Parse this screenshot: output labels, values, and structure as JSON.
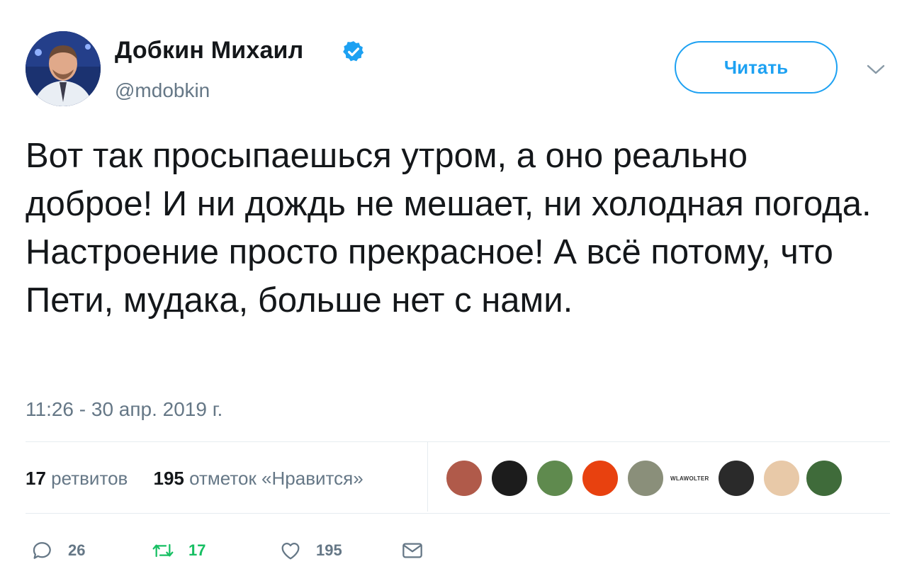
{
  "author": {
    "name": "Добкин Михаил",
    "handle": "@mdobkin",
    "avatar_icon": "avatar-photo",
    "verified_icon": "verified-badge-icon"
  },
  "follow_button": {
    "label": "Читать"
  },
  "menu_icon": "chevron-down-icon",
  "tweet": {
    "text": "Вот так просыпаешься утром, а оно реально доброе! И ни дождь не мешает, ни холодная погода. Настроение просто прекрасное! А всё потому, что Пети, мудака, больше нет с нами.",
    "timestamp": "11:26 - 30 апр. 2019 г."
  },
  "stats": {
    "retweets_count": "17",
    "retweets_label": "ретвитов",
    "likes_count": "195",
    "likes_label": "отметок «Нравится»"
  },
  "likers": [
    {
      "name": "liker-1",
      "color": "#b05a4a"
    },
    {
      "name": "liker-2",
      "color": "#1c1c1c"
    },
    {
      "name": "liker-3",
      "color": "#5f8a4e"
    },
    {
      "name": "liker-4",
      "color": "#e8410f"
    },
    {
      "name": "liker-5",
      "color": "#8a8f7a"
    },
    {
      "name": "liker-6",
      "label": "WLAWOLTER"
    },
    {
      "name": "liker-7",
      "color": "#2a2a2a"
    },
    {
      "name": "liker-8",
      "color": "#e8c9a8"
    },
    {
      "name": "liker-9",
      "color": "#3f6b3a"
    }
  ],
  "actions": {
    "reply_count": "26",
    "retweet_count": "17",
    "like_count": "195"
  },
  "colors": {
    "accent": "#1da1f2",
    "retweet": "#17bf63",
    "muted": "#657786"
  }
}
